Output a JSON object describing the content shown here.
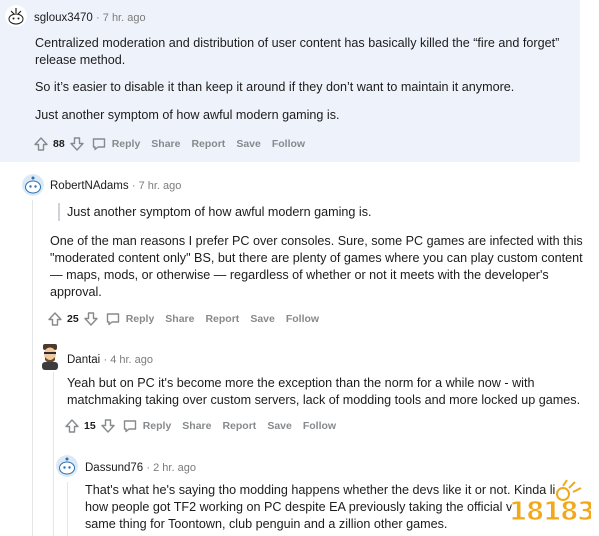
{
  "comments": [
    {
      "username": "sgloux3470",
      "time": "7 hr. ago",
      "paragraphs": [
        "Centralized moderation and distribution of user content has basically killed the “fire and forget”",
        "release method.",
        "So it’s easier to disable it than keep it around if they don’t want to maintain it anymore.",
        "Just another symptom of how awful modern gaming is."
      ],
      "score": "88"
    },
    {
      "username": "RobertNAdams",
      "time": "7 hr. ago",
      "quote": "Just another symptom of how awful modern gaming is.",
      "paragraphs": [
        "One of the man reasons I prefer PC over consoles. Sure, some PC games are infected with this",
        "\"moderated content only\" BS, but there are plenty of games where you can play custom content",
        "— maps, mods, or otherwise — regardless of whether or not it meets with the developer's",
        "approval."
      ],
      "score": "25"
    },
    {
      "username": "Dantai",
      "time": "4 hr. ago",
      "paragraphs": [
        "Yeah but on PC it's become more the exception than the norm for a while now - with",
        "matchmaking taking over custom servers, lack of modding tools and more locked up games."
      ],
      "score": "15"
    },
    {
      "username": "Dassund76",
      "time": "2 hr. ago",
      "paragraphs": [
        "That's what he's saying tho modding happens whether the devs like it or not. Kinda li",
        "how people got TF2 working on PC despite EA previously taking the official v",
        "same thing for Toontown, club penguin and a zillion other games."
      ]
    }
  ],
  "actions": {
    "reply": "Reply",
    "share": "Share",
    "report": "Report",
    "save": "Save",
    "follow": "Follow"
  },
  "watermark": "18183",
  "colors": {
    "highlight_bg": "#eef3fb",
    "meta_text": "#7c7c7c",
    "action_text": "#878a8c",
    "thread_line": "#e4e6e8"
  }
}
